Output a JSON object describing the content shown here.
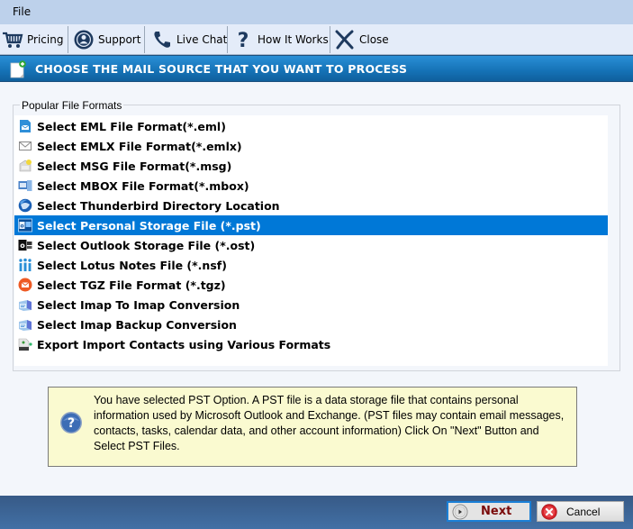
{
  "menubar": {
    "file_label": "File"
  },
  "toolbar": {
    "items": [
      {
        "label": "Pricing",
        "icon": "cart-icon"
      },
      {
        "label": "Support",
        "icon": "support-icon"
      },
      {
        "label": "Live Chat",
        "icon": "phone-icon"
      },
      {
        "label": "How It Works",
        "icon": "question-icon"
      },
      {
        "label": "Close",
        "icon": "close-icon"
      }
    ]
  },
  "header": {
    "title": "CHOOSE THE MAIL SOURCE THAT YOU WANT TO PROCESS",
    "icon": "new-document-icon"
  },
  "group": {
    "legend": "Popular File Formats",
    "items": [
      {
        "label": "Select EML File Format(*.eml)",
        "icon": "eml-icon",
        "selected": false
      },
      {
        "label": "Select EMLX File Format(*.emlx)",
        "icon": "envelope-icon",
        "selected": false
      },
      {
        "label": "Select MSG File Format(*.msg)",
        "icon": "msg-icon",
        "selected": false
      },
      {
        "label": "Select MBOX File Format(*.mbox)",
        "icon": "mbox-icon",
        "selected": false
      },
      {
        "label": "Select Thunderbird Directory Location",
        "icon": "thunderbird-icon",
        "selected": false
      },
      {
        "label": "Select Personal Storage File (*.pst)",
        "icon": "outlook-pst-icon",
        "selected": true
      },
      {
        "label": "Select Outlook Storage File (*.ost)",
        "icon": "outlook-ost-icon",
        "selected": false
      },
      {
        "label": "Select Lotus Notes File (*.nsf)",
        "icon": "lotus-notes-icon",
        "selected": false
      },
      {
        "label": "Select TGZ File Format (*.tgz)",
        "icon": "tgz-icon",
        "selected": false
      },
      {
        "label": "Select Imap To Imap Conversion",
        "icon": "imap-icon",
        "selected": false
      },
      {
        "label": "Select Imap Backup Conversion",
        "icon": "imap-backup-icon",
        "selected": false
      },
      {
        "label": "Export Import Contacts using Various Formats",
        "icon": "contacts-icon",
        "selected": false
      }
    ]
  },
  "info": {
    "icon": "help-icon",
    "text": "You have selected PST Option. A PST file is a data storage file that contains personal information used by Microsoft Outlook and Exchange. (PST files may contain email messages, contacts, tasks, calendar data, and other account information) Click On \"Next\" Button and Select PST Files."
  },
  "footer": {
    "next_label": "Next",
    "cancel_label": "Cancel"
  },
  "colors": {
    "selection": "#0078d7",
    "header_blue": "#1572b6",
    "info_bg": "#fafad0",
    "next_text": "#7a0a0a"
  }
}
